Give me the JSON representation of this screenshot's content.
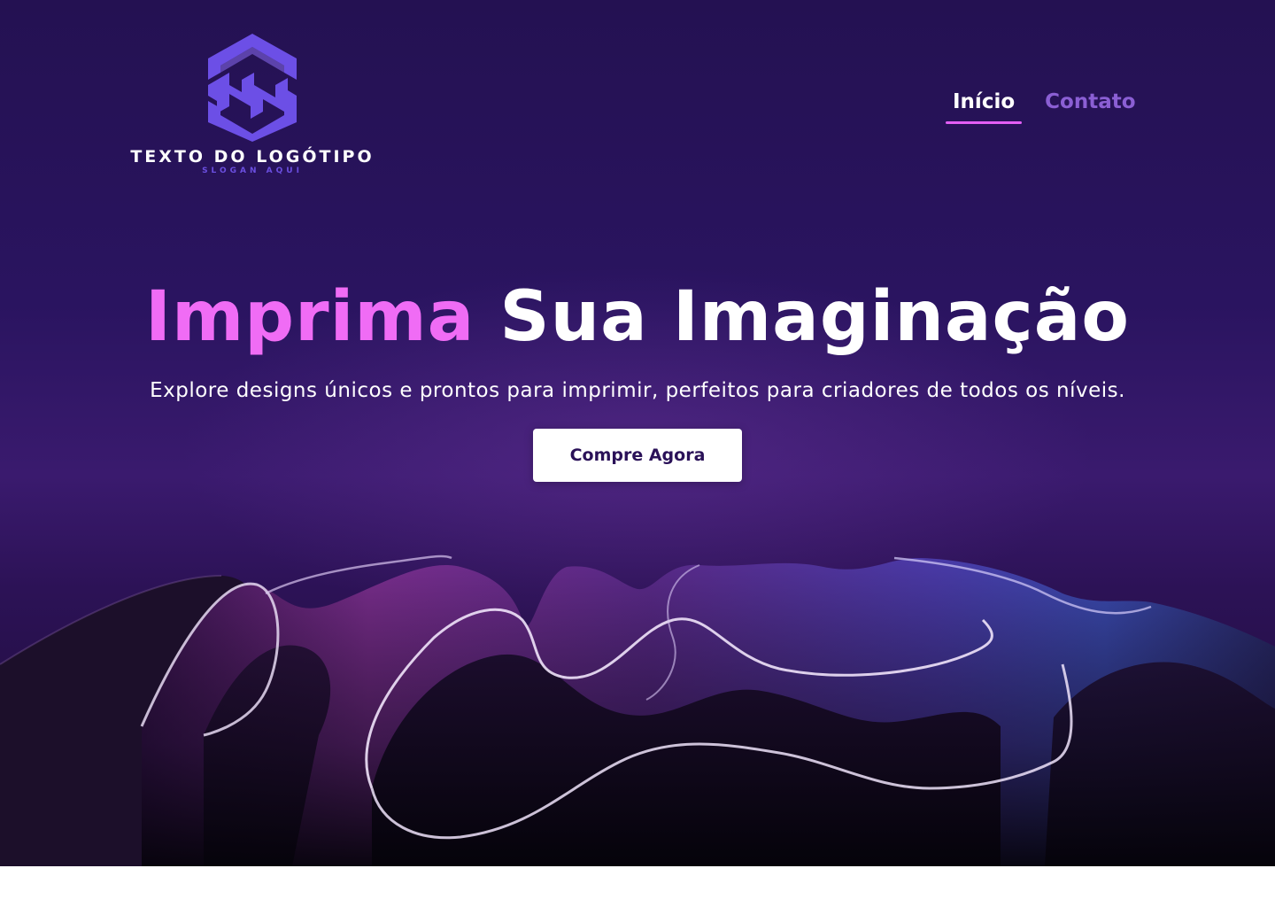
{
  "brand": {
    "logo_text": "TEXTO DO LOGÓTIPO",
    "slogan": "SLOGAN AQUI",
    "logo_color": "#6c4fe6"
  },
  "nav": {
    "items": [
      {
        "label": "Início",
        "active": true
      },
      {
        "label": "Contato",
        "active": false
      }
    ]
  },
  "hero": {
    "headline_accent": "Imprima",
    "headline_main": "Sua Imaginação",
    "subtitle": "Explore designs únicos e prontos para imprimir, perfeitos para criadores de todos os níveis.",
    "cta_label": "Compre Agora",
    "background_image": "abstract-wavy-ribbons"
  },
  "colors": {
    "background": "#241152",
    "accent_pink": "#f06cf5",
    "nav_muted": "#8b5fd4",
    "underline": "#e25ef5",
    "button_text": "#2a1158"
  }
}
